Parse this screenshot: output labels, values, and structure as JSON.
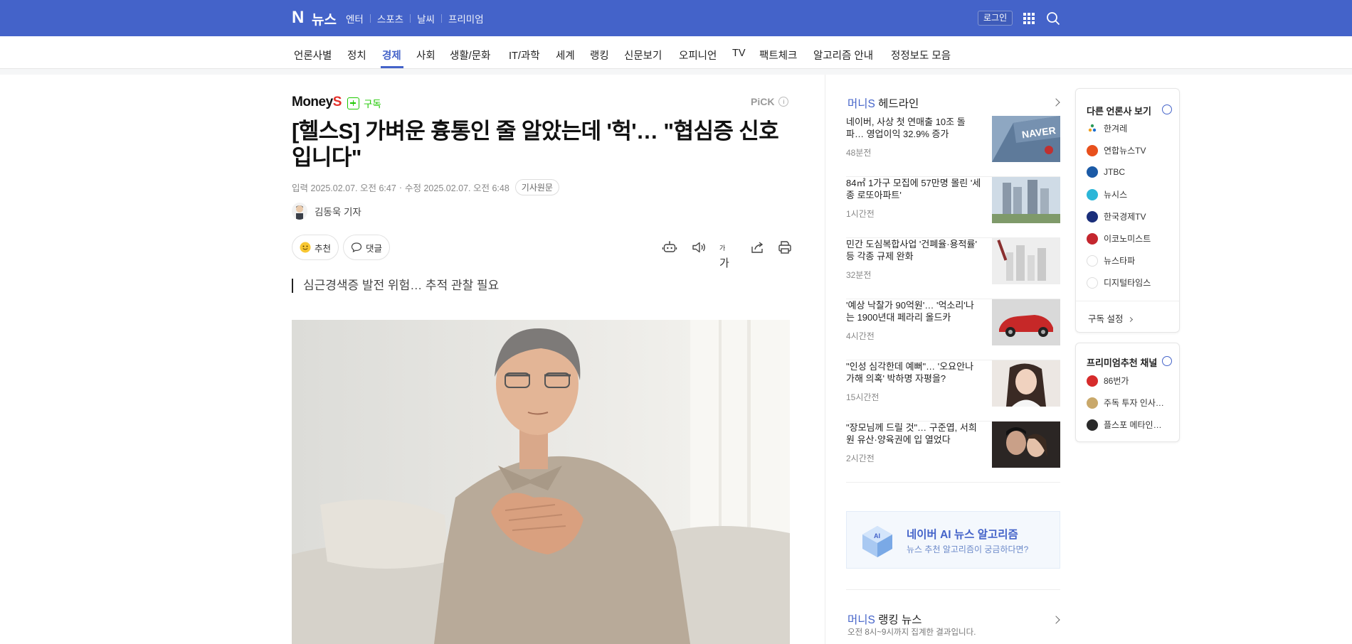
{
  "topbar": {
    "logo_letter": "N",
    "logo_text": "뉴스",
    "links": [
      "엔터",
      "스포츠",
      "날씨",
      "프리미엄"
    ],
    "login": "로그인"
  },
  "categories": [
    "언론사별",
    "정치",
    "경제",
    "사회",
    "생활/문화",
    "IT/과학",
    "세계",
    "랭킹",
    "신문보기",
    "오피니언",
    "TV",
    "팩트체크",
    "알고리즘 안내",
    "정정보도 모음"
  ],
  "active_category": "경제",
  "article": {
    "press_name": "Money",
    "press_name_accent": "S",
    "subscribe": "구독",
    "pick": "PiCK",
    "pick_info": "i",
    "title": "[헬스S] 가벼운 흉통인 줄 알았는데 '헉'… \"협심증 신호입니다\"",
    "input_label": "입력",
    "input_date": "2025.02.07. 오전 6:47",
    "modified_label": "수정",
    "modified_date": "2025.02.07. 오전 6:48",
    "original_link": "기사원문",
    "reporter": "김동욱 기자",
    "recommend": "추천",
    "comment": "댓글",
    "font_size_glyph": "가",
    "font_size_small": "가",
    "summary": "심근경색증 발전 위험… 추적 관찰 필요"
  },
  "headlines": {
    "brand": "머니S",
    "title": "헤드라인",
    "items": [
      {
        "title": "네이버, 사상 첫 연매출 10조 돌파… 영업이익 32.9% 증가",
        "time": "48분전",
        "thumb_text": "NAVER"
      },
      {
        "title": "84㎡ 1가구 모집에 57만명 몰린 '세종 로또아파트'",
        "time": "1시간전"
      },
      {
        "title": "민간 도심복합사업 '건폐율·용적률' 등 각종 규제 완화",
        "time": "32분전"
      },
      {
        "title": "'예상 낙찰가 90억원'… '억소리'나는 1900년대 페라리 올드카",
        "time": "4시간전"
      },
      {
        "title": "\"인성 심각한데 예뻐\"… '오요안나 가해 의혹' 박하명 자평을?",
        "time": "15시간전"
      },
      {
        "title": "\"장모님께 드릴 것\"… 구준엽, 서희원 유산·양육권에 입 열었다",
        "time": "2시간전"
      }
    ]
  },
  "ai_box": {
    "badge": "AI",
    "title": "네이버 AI 뉴스 알고리즘",
    "subtitle": "뉴스 추천 알고리즘이 궁금하다면?"
  },
  "ranking": {
    "brand": "머니S",
    "title": "랭킹 뉴스",
    "subtitle": "오전 8시~9시까지 집계한 결과입니다."
  },
  "other_press": {
    "title": "다른 언론사 보기",
    "items": [
      {
        "name": "한겨레",
        "color": "#e9f3fb"
      },
      {
        "name": "연합뉴스TV",
        "color": "#e8501c"
      },
      {
        "name": "JTBC",
        "color": "#1b5aa6"
      },
      {
        "name": "뉴시스",
        "color": "#2bb6d8"
      },
      {
        "name": "한국경제TV",
        "color": "#1a2e7a"
      },
      {
        "name": "이코노미스트",
        "color": "#c4262e"
      },
      {
        "name": "뉴스타파",
        "color": "#f0f0f0"
      },
      {
        "name": "디지털타임스",
        "color": "#f0f0f0"
      }
    ],
    "setting": "구독 설정"
  },
  "premium": {
    "title": "프리미엄추천 채널",
    "items": [
      {
        "name": "86번가",
        "color": "#d62b2b"
      },
      {
        "name": "주독 투자 인사…",
        "color": "#c9a86a"
      },
      {
        "name": "플스포 메타인…",
        "color": "#2a2a2a"
      }
    ]
  },
  "colors": {
    "brand_blue": "#4463c9",
    "subscribe_green": "#1ec800",
    "moneys_red": "#e5312a"
  }
}
